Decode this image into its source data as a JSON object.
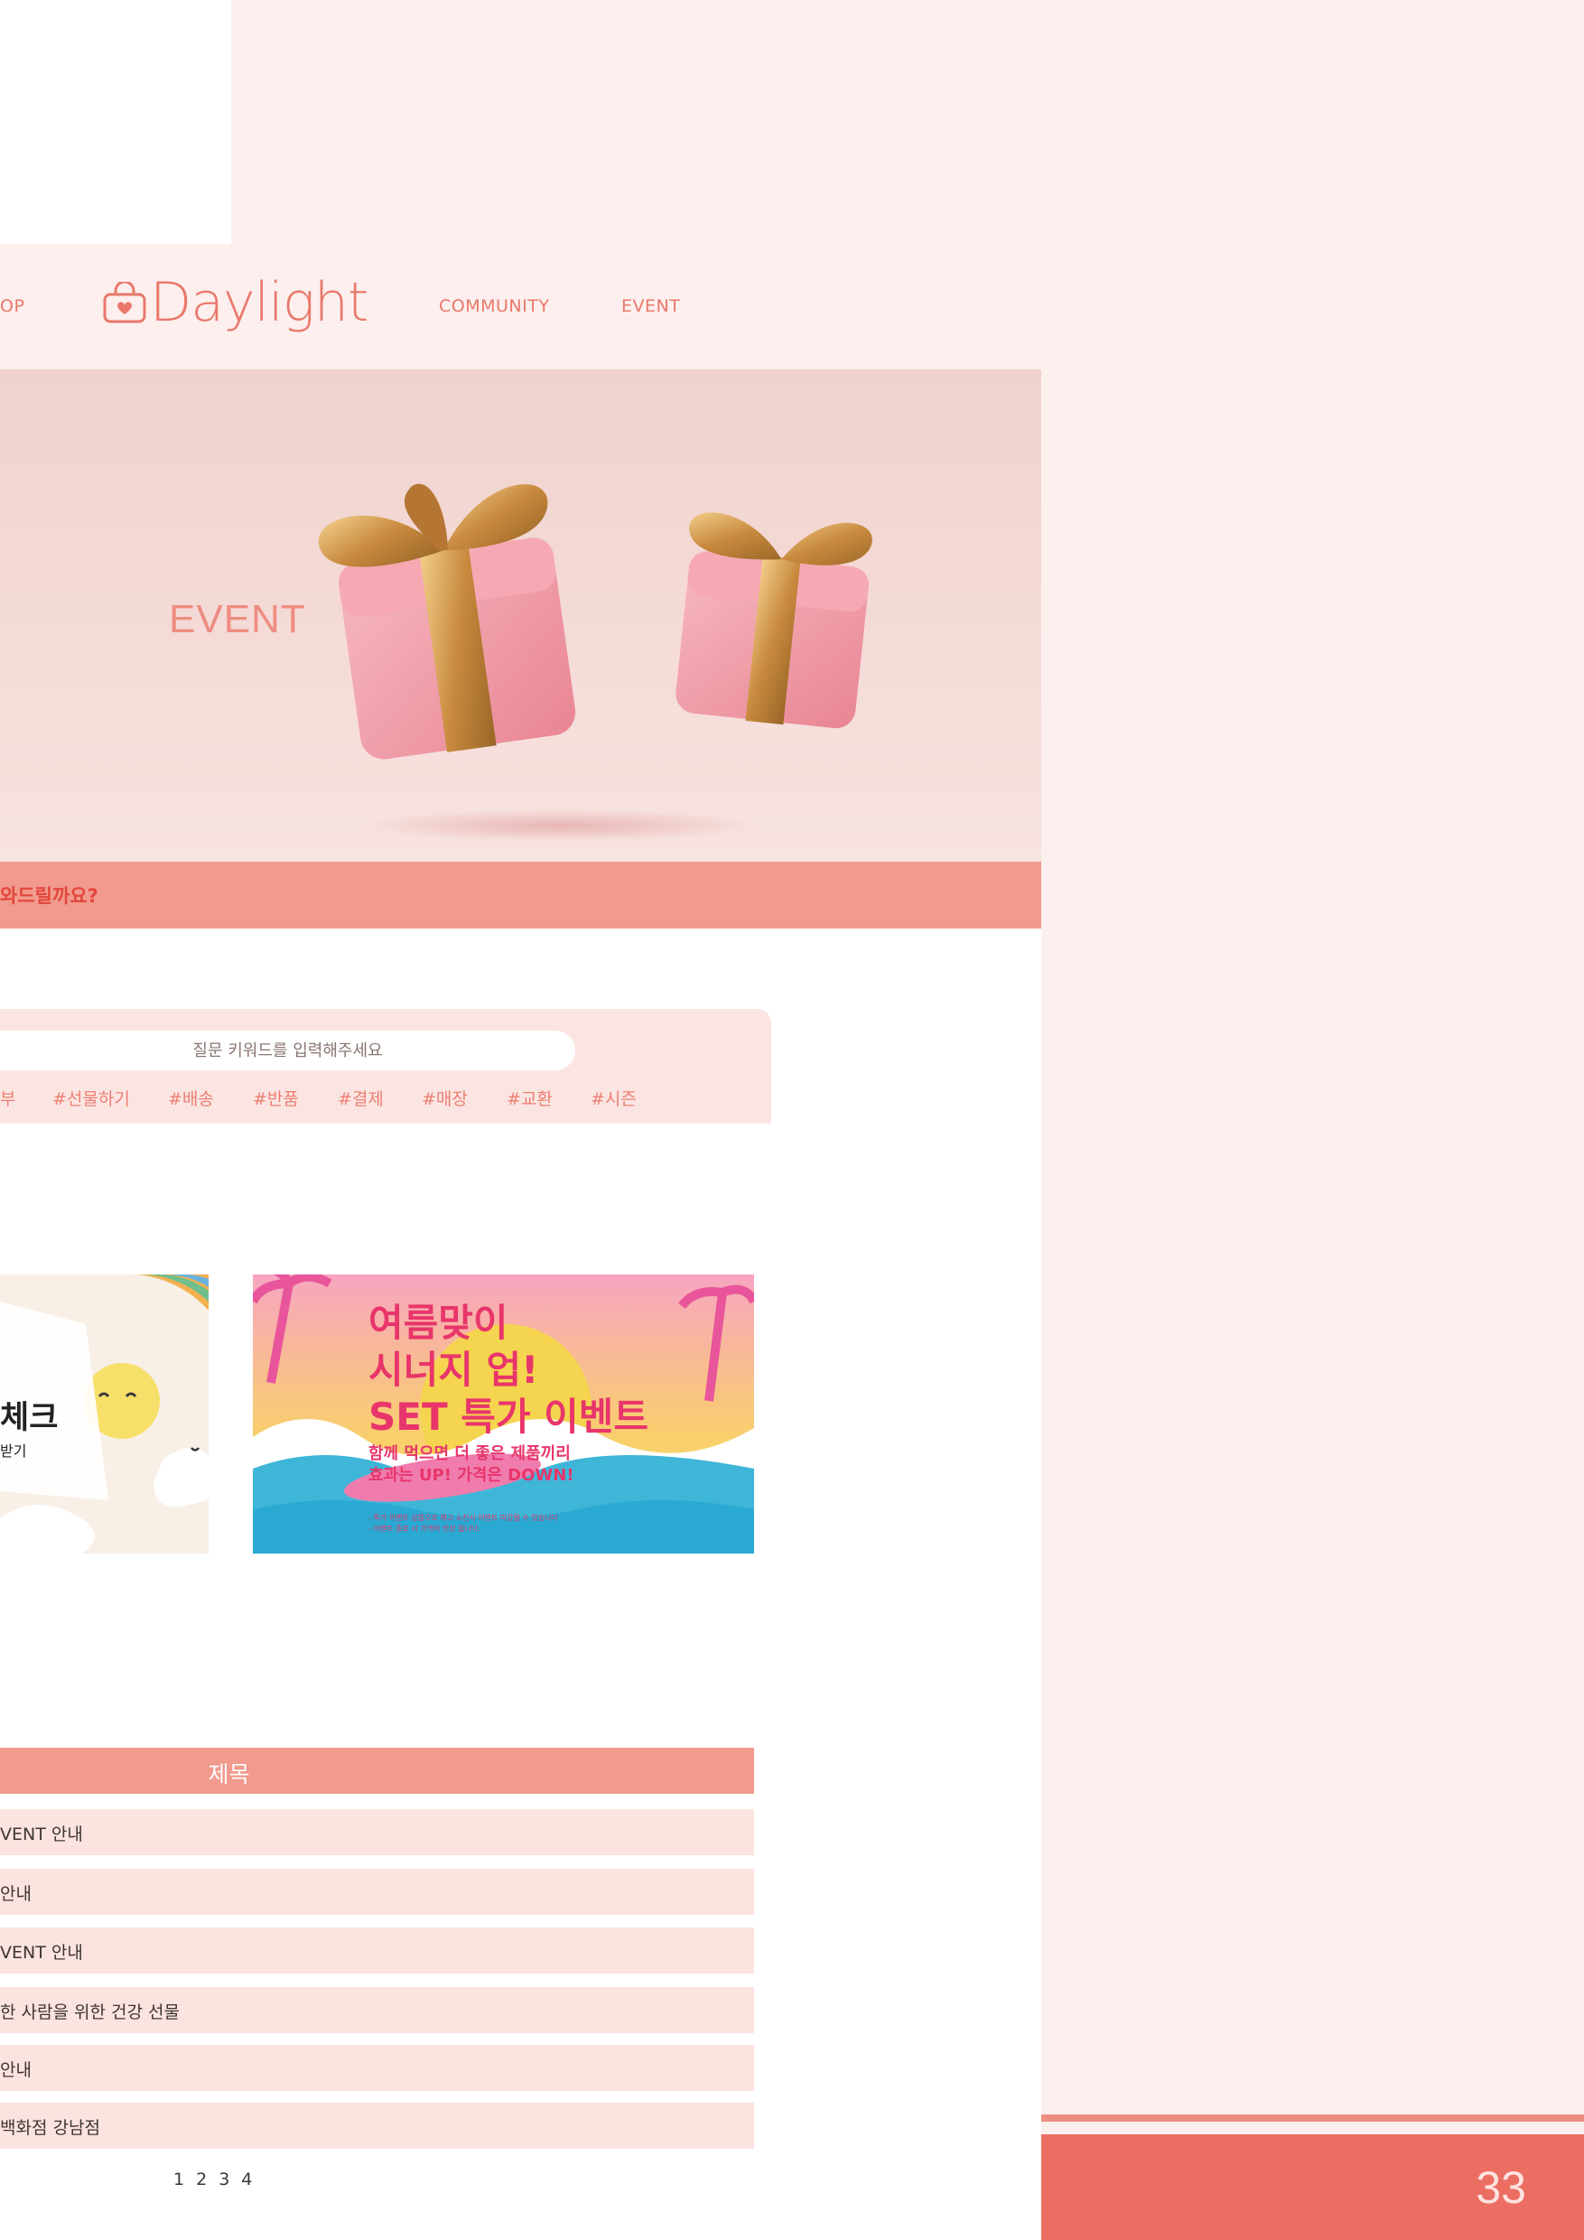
{
  "nav": {
    "shop_partial": "OP",
    "logo_text": "Daylight",
    "community": "COMMUNITY",
    "event": "EVENT"
  },
  "hero": {
    "title": "EVENT"
  },
  "help": {
    "text_partial": "와드릴까요?"
  },
  "search": {
    "placeholder": "질문 키워드를 입력해주세요",
    "tags": [
      "부",
      "#선물하기",
      "#배송",
      "#반품",
      "#결제",
      "#매장",
      "#교환",
      "#시즌"
    ]
  },
  "banners": {
    "left": {
      "headline_partial": "체크",
      "sub_partial": "받기"
    },
    "right": {
      "line1": "여름맞이",
      "line2": "시너지 업!",
      "line3": "SET 특가 이벤트",
      "line4": "함께 먹으면 더 좋은 제품끼리",
      "line5": "효과는 UP! 가격은 DOWN!",
      "fine1": "- 특가 이벤트 상품으로 재고 소진시 이벤트 마감될 수 있습니다",
      "fine2": "- 이벤트 종료 시 가격이 인상 됩니다."
    }
  },
  "table": {
    "header_title": "제목",
    "rows": [
      "VENT 안내",
      "안내",
      "VENT 안내",
      "한 사람을 위한 건강 선물",
      "안내",
      "백화점 강남점"
    ]
  },
  "pagination": [
    "1",
    "2",
    "3",
    "4"
  ],
  "footer": {
    "page_number": "33"
  },
  "colors": {
    "accent": "#ec6e62",
    "salmon": "#f19a8d",
    "pink_bg": "#fcf0ee",
    "row_bg": "#fbe3e0"
  }
}
